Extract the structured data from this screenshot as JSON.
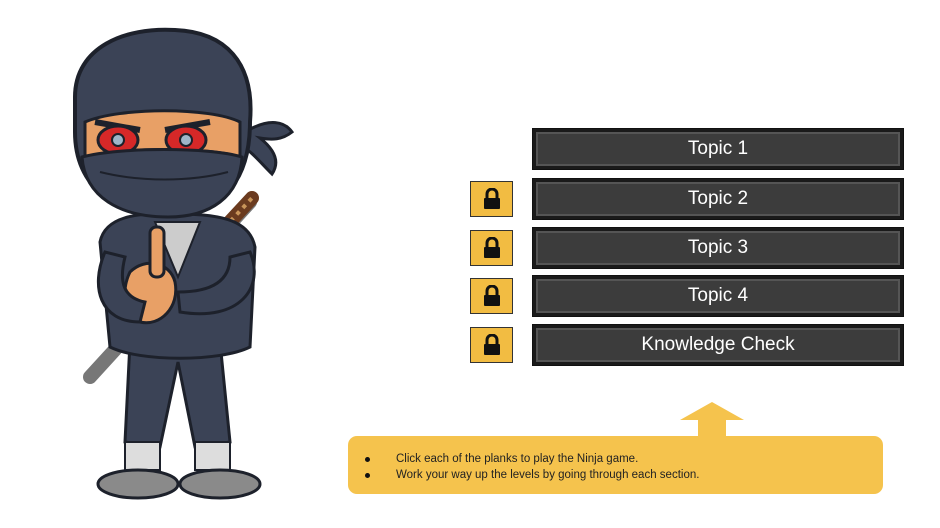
{
  "character": {
    "icon": "ninja-character"
  },
  "topics": [
    {
      "label": "Topic 1",
      "locked": false
    },
    {
      "label": "Topic 2",
      "locked": true
    },
    {
      "label": "Topic 3",
      "locked": true
    },
    {
      "label": "Topic 4",
      "locked": true
    },
    {
      "label": "Knowledge Check",
      "locked": true
    }
  ],
  "instructions": [
    "Click each of the planks to play the Ninja game.",
    "Work your way up the levels by going through each section."
  ],
  "colors": {
    "plank": "#3c3c3c",
    "lock": "#f2bc42",
    "instructions_bg": "#f5c34d",
    "arrow": "#f5c34d"
  }
}
